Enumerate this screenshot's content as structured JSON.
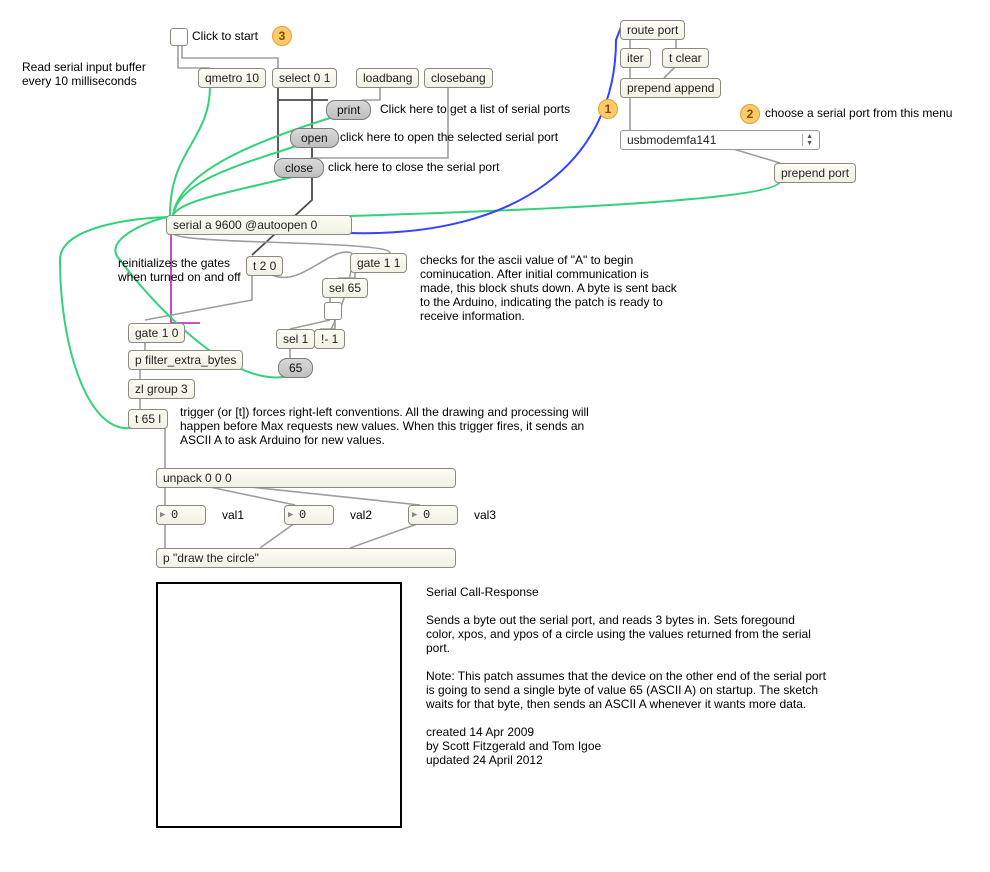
{
  "topControls": {
    "clickToStart": "Click to start",
    "bubble3": "3"
  },
  "readSerial": "Read serial input buffer\nevery 10 milliseconds",
  "boxes": {
    "qmetro": "qmetro 10",
    "select01": "select 0 1",
    "loadbang": "loadbang",
    "closebang": "closebang",
    "print": "print",
    "open": "open",
    "close": "close",
    "serial": "serial a 9600 @autoopen 0",
    "t20": "t 2 0",
    "sel65": "sel 65",
    "gate11": "gate 1 1",
    "sel1": "sel 1",
    "bangnot1": "!- 1",
    "msg65": "65",
    "gate10": "gate 1 0",
    "pfilter": "p filter_extra_bytes",
    "zlgroup": "zl group 3",
    "t65l": "t 65 l",
    "unpack": "unpack 0 0 0",
    "pdraw": "p \"draw the circle\"",
    "routeport": "route port",
    "iter": "iter",
    "tclear": "t clear",
    "prependAppend": "prepend append",
    "prependPort": "prepend port"
  },
  "comments": {
    "printHelp": "Click here to get a list of serial ports",
    "openHelp": "click here to open the selected serial port",
    "closeHelp": "click here to close the serial port",
    "reinit": "reinitializes the gates\nwhen turned on and off",
    "asciiA": "checks for the ascii value of \"A\" to begin cominucation.  After initial communication is made, this block shuts down. A byte is sent back to the Arduino, indicating the patch is ready to receive information.",
    "trigger": "trigger (or [t]) forces right-left conventions.  All the drawing and processing will happen before Max requests new values. When this trigger fires, it sends an ASCII A to ask Arduino for new values.",
    "val1": "val1",
    "val2": "val2",
    "val3": "val3",
    "chooseSerial": "choose a serial port from this menu"
  },
  "bubbles": {
    "b1": "1",
    "b2": "2",
    "b3": "3"
  },
  "umenu": {
    "selected": "usbmodemfa141"
  },
  "nums": {
    "n1": "0",
    "n2": "0",
    "n3": "0"
  },
  "description": {
    "title": "Serial Call-Response",
    "p1": "Sends a byte out the serial port, and reads 3 bytes in.  Sets foregound color, xpos, and ypos of a circle using the values returned from the serial port.",
    "p2": "Note: This patch assumes that the device on the other end of the serial port is going to send a single byte of value 65 (ASCII A) on startup. The sketch waits for that byte, then sends an ASCII A whenever it wants more data.",
    "p3": "created 14 Apr 2009\nby Scott Fitzgerald and Tom Igoe\nupdated 24 April 2012"
  }
}
